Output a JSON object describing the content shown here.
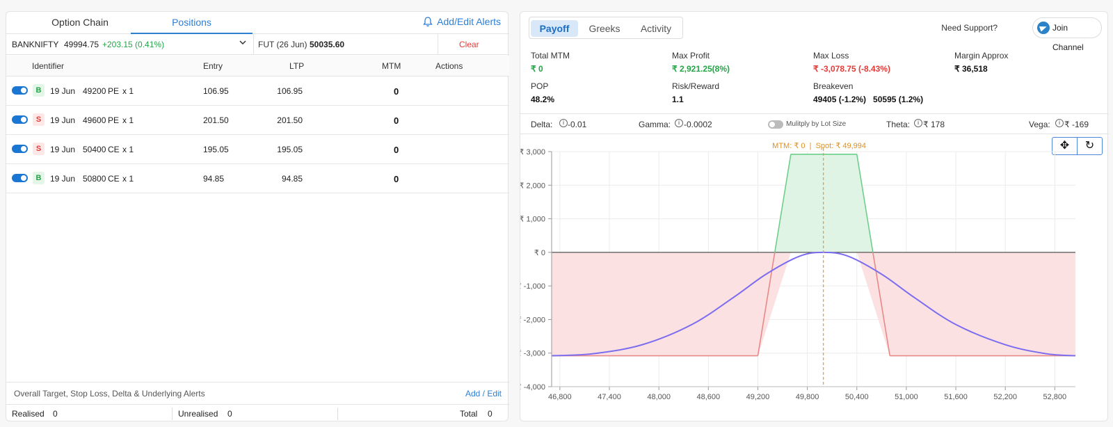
{
  "left": {
    "tabs": [
      "Option Chain",
      "Positions"
    ],
    "active_tab": "Positions",
    "alerts_label": "Add/Edit Alerts",
    "underlying": "BANKNIFTY",
    "spot": "49994.75",
    "change": "+203.15 (0.41%)",
    "fut_label": "FUT (26 Jun)",
    "fut_price": "50035.60",
    "clear_label": "Clear",
    "headers": [
      "Identifier",
      "Entry",
      "LTP",
      "MTM",
      "Actions"
    ],
    "positions": [
      {
        "side": "B",
        "expiry": "19 Jun",
        "strike": "49200",
        "type": "PE",
        "qty": "x 1",
        "entry": "106.95",
        "ltp": "106.95",
        "mtm": "0"
      },
      {
        "side": "S",
        "expiry": "19 Jun",
        "strike": "49600",
        "type": "PE",
        "qty": "x 1",
        "entry": "201.50",
        "ltp": "201.50",
        "mtm": "0"
      },
      {
        "side": "S",
        "expiry": "19 Jun",
        "strike": "50400",
        "type": "CE",
        "qty": "x 1",
        "entry": "195.05",
        "ltp": "195.05",
        "mtm": "0"
      },
      {
        "side": "B",
        "expiry": "19 Jun",
        "strike": "50800",
        "type": "CE",
        "qty": "x 1",
        "entry": "94.85",
        "ltp": "94.85",
        "mtm": "0"
      }
    ],
    "footer_alerts": "Overall Target, Stop Loss, Delta & Underlying Alerts",
    "add_edit_label": "Add / Edit",
    "realised_label": "Realised",
    "realised_value": "0",
    "unrealised_label": "Unrealised",
    "unrealised_value": "0",
    "total_label": "Total",
    "total_value": "0"
  },
  "right": {
    "tabs": [
      "Payoff",
      "Greeks",
      "Activity"
    ],
    "active_tab": "Payoff",
    "support_label": "Need Support?",
    "join_label": "Join Channel",
    "stats": {
      "total_mtm_label": "Total MTM",
      "total_mtm": "₹ 0",
      "max_profit_label": "Max Profit",
      "max_profit": "₹ 2,921.25(8%)",
      "max_loss_label": "Max Loss",
      "max_loss": "₹ -3,078.75 (-8.43%)",
      "margin_label": "Margin Approx",
      "margin": "₹ 36,518",
      "pop_label": "POP",
      "pop": "48.2%",
      "rr_label": "Risk/Reward",
      "rr": "1.1",
      "breakeven_label": "Breakeven",
      "breakeven": "49405 (-1.2%)   50595 (1.2%)"
    },
    "greeks": {
      "delta_label": "Delta:",
      "delta": "-0.01",
      "gamma_label": "Gamma:",
      "gamma": "-0.0002",
      "multiply_label": "Mulitply by Lot Size",
      "theta_label": "Theta:",
      "theta": "₹ 178",
      "vega_label": "Vega:",
      "vega": "₹ -169"
    },
    "annotation": "MTM: ₹ 0  |  Spot: ₹ 49,994",
    "colors": {
      "profit_fill": "#dff4e4",
      "loss_fill": "#fbe1e2",
      "payoff_line": "#e88888",
      "expiry_line": "#7b6cf0",
      "spot_line": "#e0a23a"
    }
  },
  "chart_data": {
    "type": "line",
    "xlim": [
      46700,
      53050
    ],
    "ylim": [
      -4000,
      3000
    ],
    "x_ticks": [
      46800,
      47400,
      48000,
      48600,
      49200,
      49800,
      50400,
      51000,
      51600,
      52200,
      52800
    ],
    "x_tick_labels": [
      "46,800",
      "47,400",
      "48,000",
      "48,600",
      "49,200",
      "49,800",
      "50,400",
      "51,000",
      "51,600",
      "52,200",
      "52,800"
    ],
    "y_ticks": [
      3000,
      2000,
      1000,
      0,
      -1000,
      -2000,
      -3000,
      -4000
    ],
    "y_tick_labels": [
      "₹ 3,000",
      "₹ 2,000",
      "₹ 1,000",
      "₹ 0",
      "₹ -1,000",
      "₹ -2,000",
      "₹ -3,000",
      "₹ -4,000"
    ],
    "spot": 49994,
    "series": [
      {
        "x": [
          46700,
          49200,
          49600,
          50400,
          50800,
          53050
        ],
        "y": [
          -3079,
          -3079,
          2921,
          2921,
          -3079,
          -3079
        ]
      },
      {
        "x": [
          46700,
          47200,
          47800,
          48400,
          48900,
          49300,
          49700,
          49994,
          50300,
          50700,
          51100,
          51600,
          52200,
          52700,
          53050
        ],
        "y": [
          -3079,
          -3020,
          -2750,
          -2150,
          -1350,
          -650,
          -120,
          0,
          -120,
          -650,
          -1350,
          -2150,
          -2750,
          -3020,
          -3079
        ]
      }
    ]
  }
}
